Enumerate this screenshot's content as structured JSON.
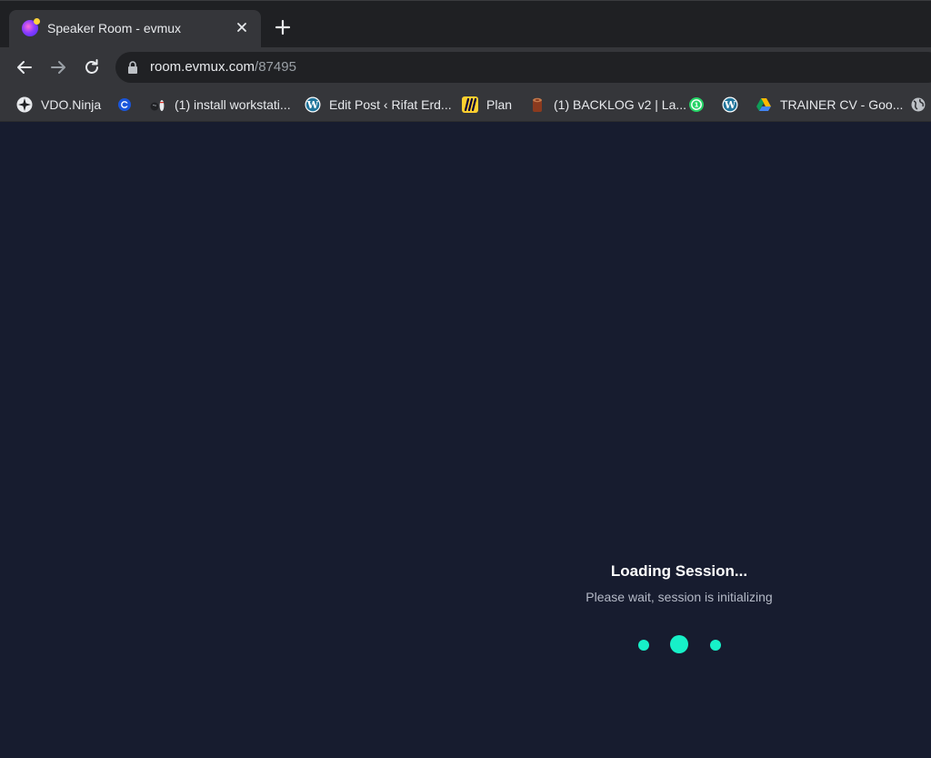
{
  "browser": {
    "tab": {
      "title": "Speaker Room - evmux",
      "close_icon": "close-icon",
      "favicon": "evmux-favicon"
    },
    "new_tab_icon": "plus-icon",
    "nav": {
      "back_icon": "arrow-left-icon",
      "forward_icon": "arrow-right-icon",
      "reload_icon": "reload-icon"
    },
    "address": {
      "host": "room.evmux.com",
      "path": "/87495",
      "lock_icon": "lock-icon"
    },
    "bookmarks": [
      {
        "label": "VDO.Ninja",
        "icon": "vdo-ninja-icon"
      },
      {
        "label": "",
        "icon": "blue-circle-c-icon"
      },
      {
        "label": "(1) install workstati...",
        "icon": "bowling-icon"
      },
      {
        "label": "Edit Post ‹ Rifat Erd...",
        "icon": "wordpress-icon"
      },
      {
        "label": "Plan",
        "icon": "miro-icon"
      },
      {
        "label": "(1) BACKLOG v2 | La...",
        "icon": "trello-log-icon"
      },
      {
        "label": "",
        "icon": "whatsapp-icon"
      },
      {
        "label": "",
        "icon": "wordpress-icon"
      },
      {
        "label": "TRAINER CV - Goo...",
        "icon": "google-drive-icon"
      },
      {
        "label": "",
        "icon": "globe-icon"
      }
    ]
  },
  "main": {
    "loading_title": "Loading Session...",
    "loading_subtitle": "Please wait, session is initializing",
    "spinner_color": "#17f0c8",
    "background_color": "#171c2f"
  }
}
